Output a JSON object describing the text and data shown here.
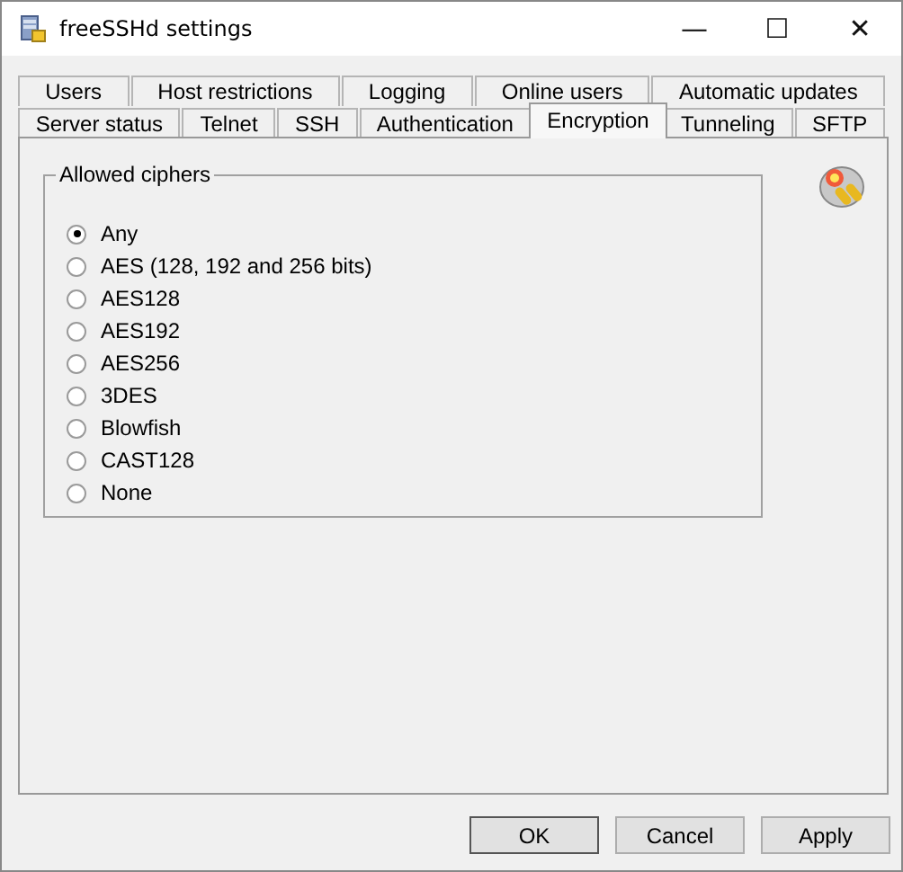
{
  "window": {
    "title": "freeSSHd settings",
    "controls": [
      "—",
      "☐",
      "✕"
    ]
  },
  "tab_rows": [
    [
      {
        "label": "Users",
        "selected": false
      },
      {
        "label": "Host restrictions",
        "selected": false
      },
      {
        "label": "Logging",
        "selected": false
      },
      {
        "label": "Online users",
        "selected": false
      },
      {
        "label": "Automatic updates",
        "selected": false
      }
    ],
    [
      {
        "label": "Server status",
        "selected": false
      },
      {
        "label": "Telnet",
        "selected": false
      },
      {
        "label": "SSH",
        "selected": false
      },
      {
        "label": "Authentication",
        "selected": false
      },
      {
        "label": "Encryption",
        "selected": true
      },
      {
        "label": "Tunneling",
        "selected": false
      },
      {
        "label": "SFTP",
        "selected": false
      }
    ]
  ],
  "group": {
    "title": "Allowed ciphers",
    "options": [
      {
        "label": "Any",
        "selected": true
      },
      {
        "label": "AES (128, 192 and 256 bits)",
        "selected": false
      },
      {
        "label": "AES128",
        "selected": false
      },
      {
        "label": "AES192",
        "selected": false
      },
      {
        "label": "AES256",
        "selected": false
      },
      {
        "label": "3DES",
        "selected": false
      },
      {
        "label": "Blowfish",
        "selected": false
      },
      {
        "label": "CAST128",
        "selected": false
      },
      {
        "label": "None",
        "selected": false
      }
    ]
  },
  "buttons": [
    "OK",
    "Cancel",
    "Apply"
  ]
}
